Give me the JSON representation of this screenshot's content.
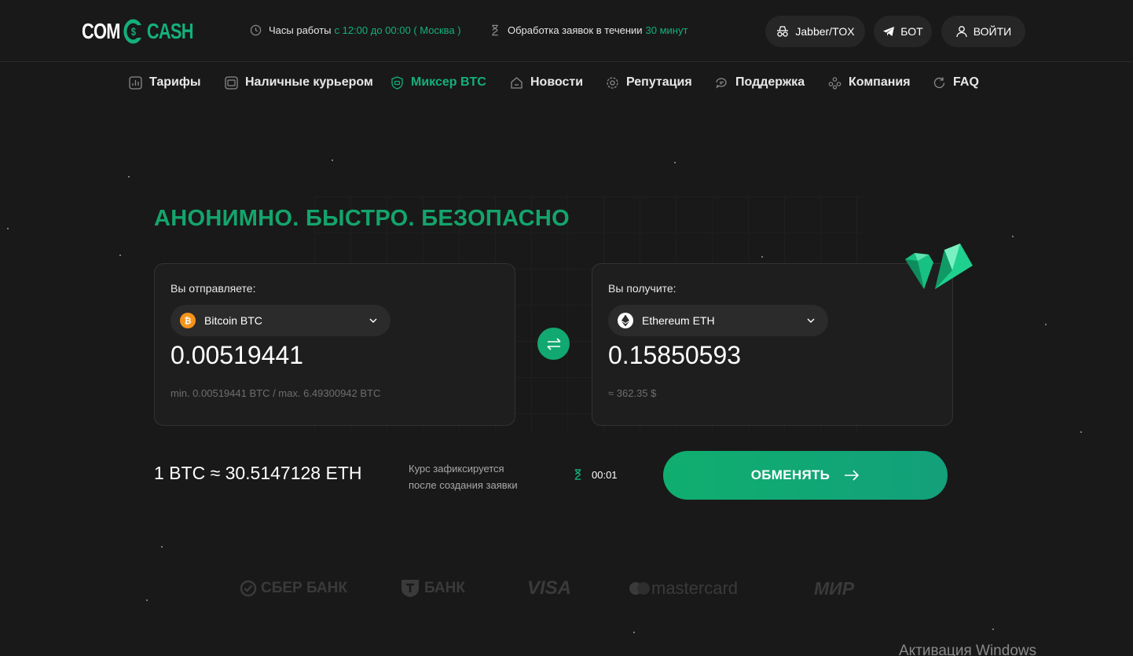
{
  "logo": {
    "left": "COM",
    "right": "CASH"
  },
  "header": {
    "hours_label": "Часы работы",
    "hours_value": "с 12:00 до 00:00 ( Москва )",
    "processing_label": "Обработка заявок в течении",
    "processing_value": "30 минут",
    "jabber": "Jabber/TOX",
    "bot": "БОТ",
    "login": "ВОЙТИ"
  },
  "nav": [
    {
      "label": "Тарифы",
      "icon": "chart-icon"
    },
    {
      "label": "Наличные курьером",
      "icon": "cash-icon"
    },
    {
      "label": "Миксер BTC",
      "icon": "shield-icon",
      "active": true
    },
    {
      "label": "Новости",
      "icon": "home-icon"
    },
    {
      "label": "Репутация",
      "icon": "badge-icon"
    },
    {
      "label": "Поддержка",
      "icon": "chat-icon"
    },
    {
      "label": "Компания",
      "icon": "people-icon"
    },
    {
      "label": "FAQ",
      "icon": "refresh-icon"
    }
  ],
  "hero": {
    "headline": "АНОНИМНО. БЫСТРО. БЕЗОПАСНО"
  },
  "send": {
    "label": "Вы отправляете:",
    "currency": "Bitcoin BTC",
    "amount": "0.00519441",
    "limits": "min. 0.00519441 BTC / max. 6.49300942 BTC"
  },
  "receive": {
    "label": "Вы получите:",
    "currency": "Ethereum ETH",
    "amount": "0.15850593",
    "usd": "≈ 362.35 $"
  },
  "rate": {
    "text": "1 BTC ≈ 30.5147128 ETH",
    "fix_line1": "Курс зафиксируется",
    "fix_line2": "после создания заявки",
    "timer": "00:01"
  },
  "exchange_button": "ОБМЕНЯТЬ",
  "brands": [
    "СБЕР БАНК",
    "БАНК",
    "VISA",
    "mastercard",
    "МИР"
  ],
  "watermark": "Активация Windows",
  "colors": {
    "accent": "#14b07a",
    "background": "#191919",
    "card": "#1e1e1e",
    "btc": "#f7931a"
  }
}
